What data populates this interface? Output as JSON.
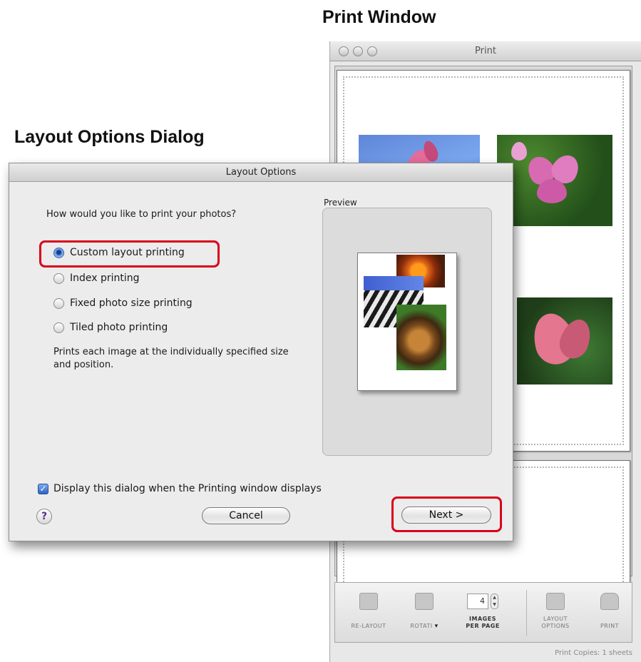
{
  "captions": {
    "print_window": "Print Window",
    "layout_dialog": "Layout Options Dialog"
  },
  "print_window": {
    "title": "Print",
    "toolbar": {
      "relayout_label": "RE-LAYOUT",
      "rotate_label": "ROTATI",
      "images_per_page_value": "4",
      "images_per_page_label_line1": "IMAGES",
      "images_per_page_label_line2": "PER PAGE",
      "layout_options_label_line1": "LAYOUT",
      "layout_options_label_line2": "OPTIONS",
      "print_label": "PRINT"
    },
    "status": "Print Copies: 1 sheets"
  },
  "dialog": {
    "title": "Layout Options",
    "question": "How would you like to print your photos?",
    "options": [
      {
        "label": "Custom layout printing",
        "selected": true
      },
      {
        "label": "Index printing",
        "selected": false
      },
      {
        "label": "Fixed photo size printing",
        "selected": false
      },
      {
        "label": "Tiled photo printing",
        "selected": false
      }
    ],
    "description": "Prints each image at the individually specified size and position.",
    "preview_label": "Preview",
    "display_checkbox_label": "Display this dialog when the Printing window displays",
    "display_checkbox_checked": true,
    "help_symbol": "?",
    "cancel_label": "Cancel",
    "next_label": "Next >"
  },
  "colors": {
    "highlight": "#d9001b",
    "accent": "#3c63a8"
  }
}
